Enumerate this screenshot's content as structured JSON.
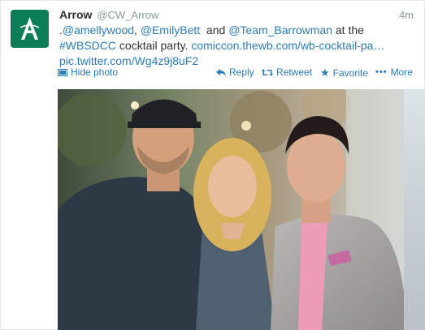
{
  "tweet": {
    "name": "Arrow",
    "handle": "@CW_Arrow",
    "time": "4m",
    "lines": [
      [
        {
          "text": ".",
          "link": false
        },
        {
          "text": "@amellywood",
          "link": true
        },
        {
          "text": ", ",
          "link": false
        },
        {
          "text": "@EmilyBett",
          "link": true
        },
        {
          "text": "  and ",
          "link": false
        },
        {
          "text": "@Team_Barrowman",
          "link": true
        },
        {
          "text": " at the",
          "link": false
        }
      ],
      [
        {
          "text": "#WBSDCC",
          "link": true
        },
        {
          "text": " cocktail party. ",
          "link": false
        },
        {
          "text": "comiccon.thewb.com/wb-cocktail-pa…",
          "link": true
        }
      ],
      [
        {
          "text": "pic.twitter.com/Wg4z9j8uF2",
          "link": true
        }
      ]
    ]
  },
  "actions": {
    "hide_photo": "Hide photo",
    "reply": "Reply",
    "retweet": "Retweet",
    "favorite": "Favorite",
    "more": "More"
  },
  "icons": {
    "avatar": "arrow-logo-icon",
    "hide_photo": "photo-icon",
    "reply": "reply-icon",
    "retweet": "retweet-icon",
    "favorite": "star-icon",
    "more": "ellipsis-icon"
  },
  "colors": {
    "link": "#2b7bb9",
    "avatar_bg": "#0b7d57",
    "muted": "#8899a6"
  }
}
